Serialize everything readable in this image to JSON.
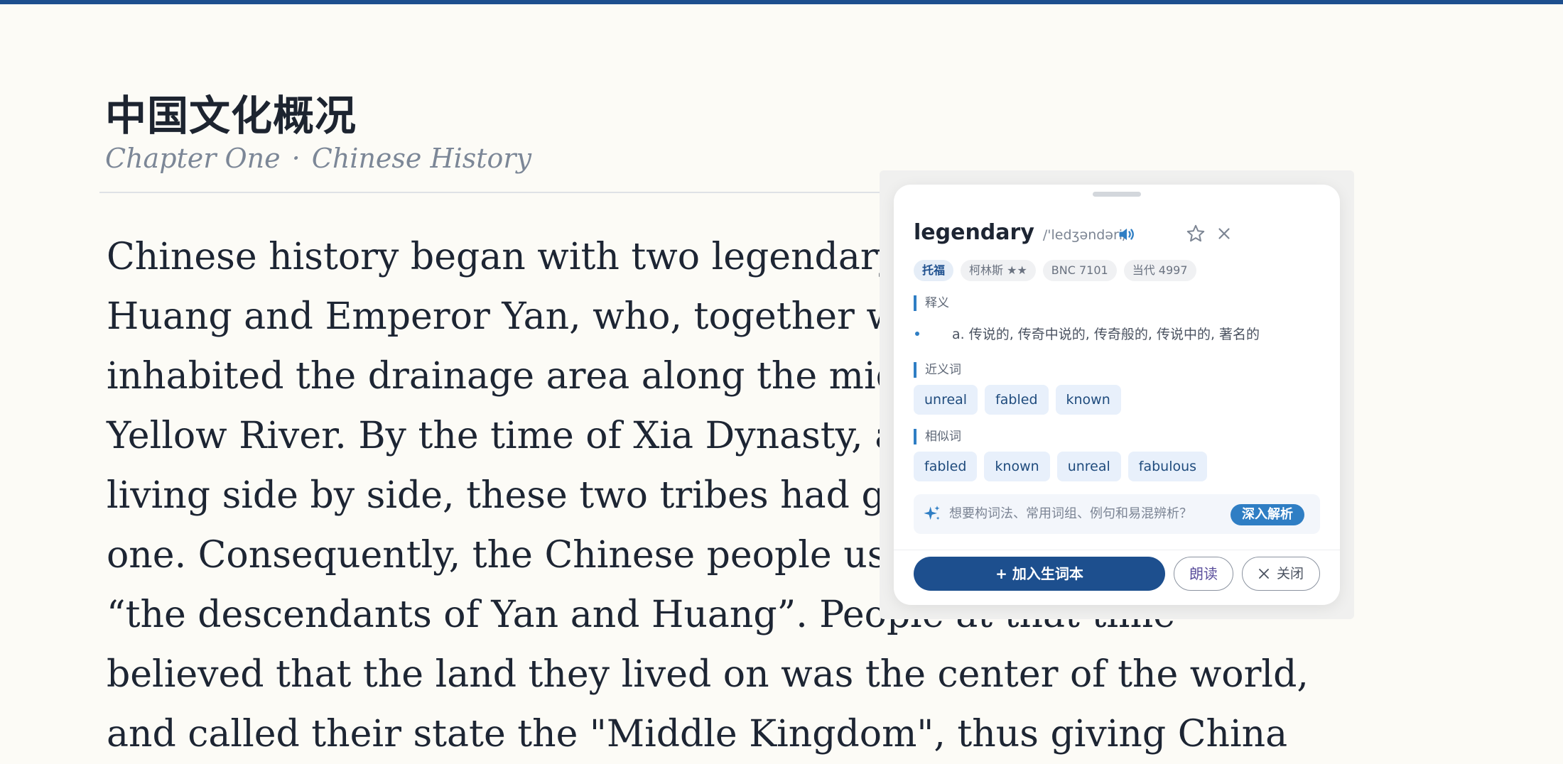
{
  "page": {
    "title": "中国文化概况",
    "chapter": "Chapter One",
    "separator": "·",
    "section": "Chinese History",
    "accent_color": "#1d4f8e"
  },
  "article": {
    "lines": [
      "Chinese history began with two legendary fi",
      "Huang and Emperor Yan, who, together wit",
      "inhabited the drainage area along the middl",
      "Yellow River. By the time of Xia Dynasty, af",
      "living side by side, these two tribes had grad",
      "one. Consequently, the Chinese people usua",
      "“the descendants of Yan and Huang”. People at that time",
      "believed that the land they lived on was the center of the world,",
      "and called their state the \"Middle Kingdom\", thus giving China"
    ]
  },
  "popup": {
    "word": "legendary",
    "phonetic": "/'ledʒəndəri/",
    "icons": {
      "speaker": "speaker-icon",
      "favorite": "star-icon",
      "close": "close-icon",
      "sparkle": "sparkle-icon"
    },
    "tags": [
      "托福",
      "柯林斯 ★★",
      "BNC 7101",
      "当代 4997"
    ],
    "definition_label": "释义",
    "definition": "a. 传说的, 传奇中说的, 传奇般的, 传说中的, 著名的",
    "synonyms_label": "近义词",
    "synonyms": [
      "unreal",
      "fabled",
      "known"
    ],
    "similar_label": "相似词",
    "similar": [
      "fabled",
      "known",
      "unreal",
      "fabulous"
    ],
    "deep_prompt": "想要构词法、常用词组、例句和易混辨析？",
    "deep_button": "深入解析",
    "add_button": "+ 加入生词本",
    "read_button": "朗读",
    "close_button": "关闭",
    "accent_color": "#2f7ec4"
  }
}
